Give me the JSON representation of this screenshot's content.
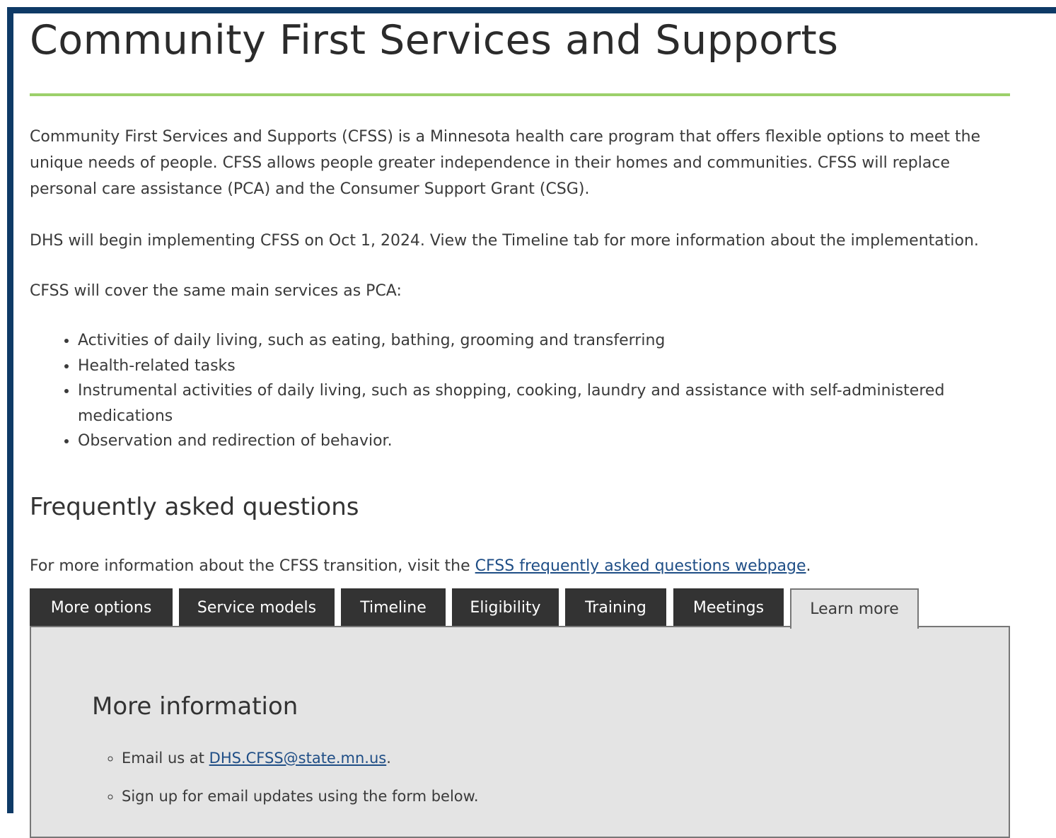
{
  "page": {
    "title": "Community First Services and Supports",
    "accent_rule_color": "#9cd06a",
    "frame_color": "#0e3a66"
  },
  "intro": {
    "paragraph": "Community First Services and Supports (CFSS) is a Minnesota health care program that offers flexible options to meet the unique needs of people. CFSS allows people greater independence in their homes and communities. CFSS will replace personal care assistance (PCA) and the Consumer Support Grant (CSG).",
    "implementation": "DHS will begin implementing CFSS on Oct 1, 2024. View the Timeline tab for more information about the implementation.",
    "coverage_lead": "CFSS will cover the same main services as PCA:"
  },
  "services": [
    "Activities of daily living, such as eating, bathing, grooming and transferring",
    "Health-related tasks",
    "Instrumental activities of daily living, such as shopping, cooking, laundry and assistance with self-administered medications",
    "Observation and redirection of behavior."
  ],
  "faq": {
    "title": "Frequently asked questions",
    "text_before": "For more information about the CFSS transition, visit the ",
    "link_text": "CFSS frequently asked questions webpage",
    "text_after": "."
  },
  "tabs": [
    {
      "label": "More options",
      "active": false
    },
    {
      "label": "Service models",
      "active": false
    },
    {
      "label": "Timeline",
      "active": false
    },
    {
      "label": "Eligibility",
      "active": false
    },
    {
      "label": "Training",
      "active": false
    },
    {
      "label": "Meetings",
      "active": false
    },
    {
      "label": "Learn more",
      "active": true
    }
  ],
  "panel": {
    "title": "More information",
    "email_prefix": "Email us at ",
    "email_link": "DHS.CFSS@state.mn.us",
    "email_suffix": ".",
    "signup": "Sign up for email updates using the form below."
  }
}
